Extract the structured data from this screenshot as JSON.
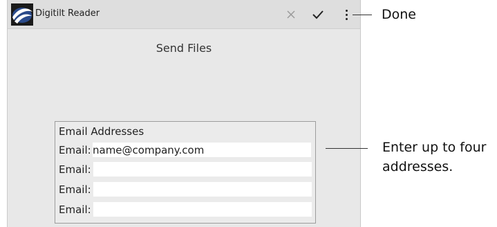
{
  "app": {
    "title": "Digitilt Reader",
    "logo_icon": "digitilt-logo-icon"
  },
  "actionbar": {
    "cancel_icon": "close-icon",
    "done_icon": "checkmark-icon",
    "overflow_icon": "overflow-menu-icon"
  },
  "screen": {
    "title": "Send Files"
  },
  "emails": {
    "heading": "Email Addresses",
    "rows": [
      {
        "label": "Email:",
        "value": "name@company.com"
      },
      {
        "label": "Email:",
        "value": ""
      },
      {
        "label": "Email:",
        "value": ""
      },
      {
        "label": "Email:",
        "value": ""
      }
    ]
  },
  "callouts": {
    "done": "Done",
    "addresses_line1": "Enter up to four",
    "addresses_line2": "addresses."
  }
}
